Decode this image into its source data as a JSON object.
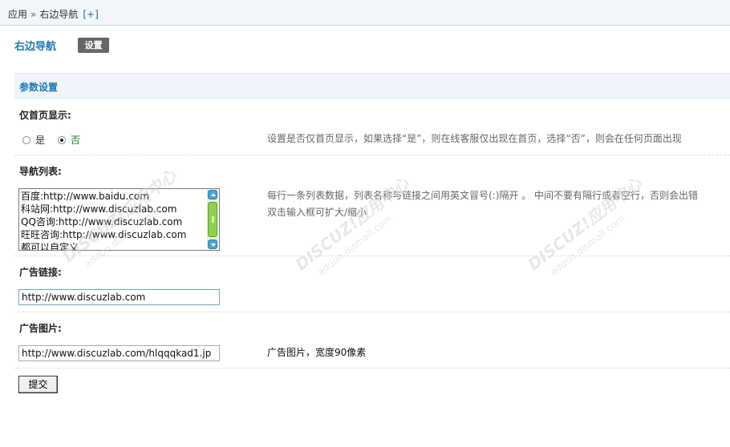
{
  "breadcrumb": {
    "app": "应用",
    "sep": "»",
    "current": "右边导航",
    "plus": "[+]"
  },
  "header": {
    "title": "右边导航",
    "settings_label": "设置"
  },
  "section": {
    "title": "参数设置"
  },
  "homepage_only": {
    "label": "仅首页显示:",
    "options": [
      {
        "label": "是",
        "checked": false
      },
      {
        "label": "否",
        "checked": true
      }
    ],
    "hint": "设置是否仅首页显示，如果选择“是”，则在线客服仅出现在首页，选择“否”，则会在任何页面出现"
  },
  "nav_list": {
    "label": "导航列表:",
    "lines": [
      "百度:http://www.baidu.com",
      "科站网:http://www.discuzlab.com",
      "QQ咨询:http://www.discuzlab.com",
      "旺旺咨询:http://www.discuzlab.com",
      "都可以自定义"
    ],
    "hint_line1": "每行一条列表数据，列表名称与链接之间用英文冒号(:)隔开 。 中间不要有隔行或者空行，否则会出错",
    "hint_line2": "双击输入框可扩大/缩小"
  },
  "ad_link": {
    "label": "广告链接:",
    "value": "http://www.discuzlab.com"
  },
  "ad_image": {
    "label": "广告图片:",
    "value": "http://www.discuzlab.com/hlqqqkad1.jp",
    "hint": "广告图片，宽度90像素"
  },
  "submit_label": "提交",
  "watermark": {
    "brand": "DISCUZ!应用中心",
    "sub": "addon.dismall.com",
    "tail": "贰道"
  },
  "colors": {
    "accent": "#1d79b8",
    "green": "#1c8a1c",
    "topbar": "#f2f6fa",
    "section": "#eef4f9"
  }
}
